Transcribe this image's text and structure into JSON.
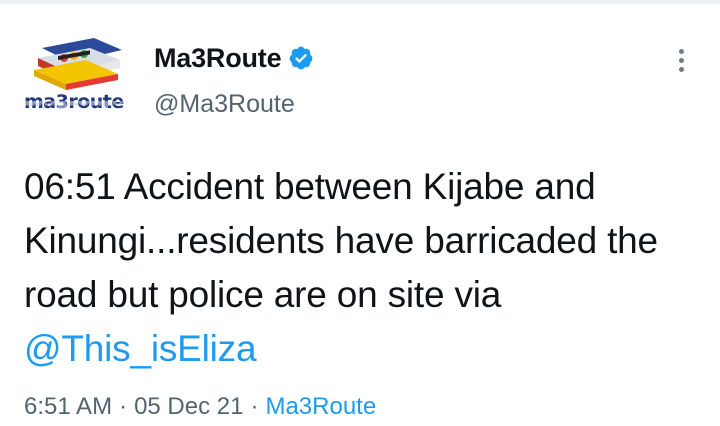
{
  "tweet": {
    "display_name": "Ma3Route",
    "handle": "@Ma3Route",
    "verified": true,
    "logo_text": "ma3route",
    "text_before_mention": "06:51 Accident between Kijabe and Kinungi...residents have barricaded the road but police are on site via ",
    "mention": "@This_isEliza",
    "time": "6:51 AM",
    "separator": "·",
    "date": "05 Dec 21",
    "source": "Ma3Route"
  },
  "icons": {
    "verified": "verified-badge-icon",
    "more": "more-options-icon",
    "avatar": "ma3route-logo"
  },
  "colors": {
    "link": "#1d9bf0",
    "verified": "#1d9bf0",
    "text": "#0f1419",
    "muted": "#536471"
  }
}
